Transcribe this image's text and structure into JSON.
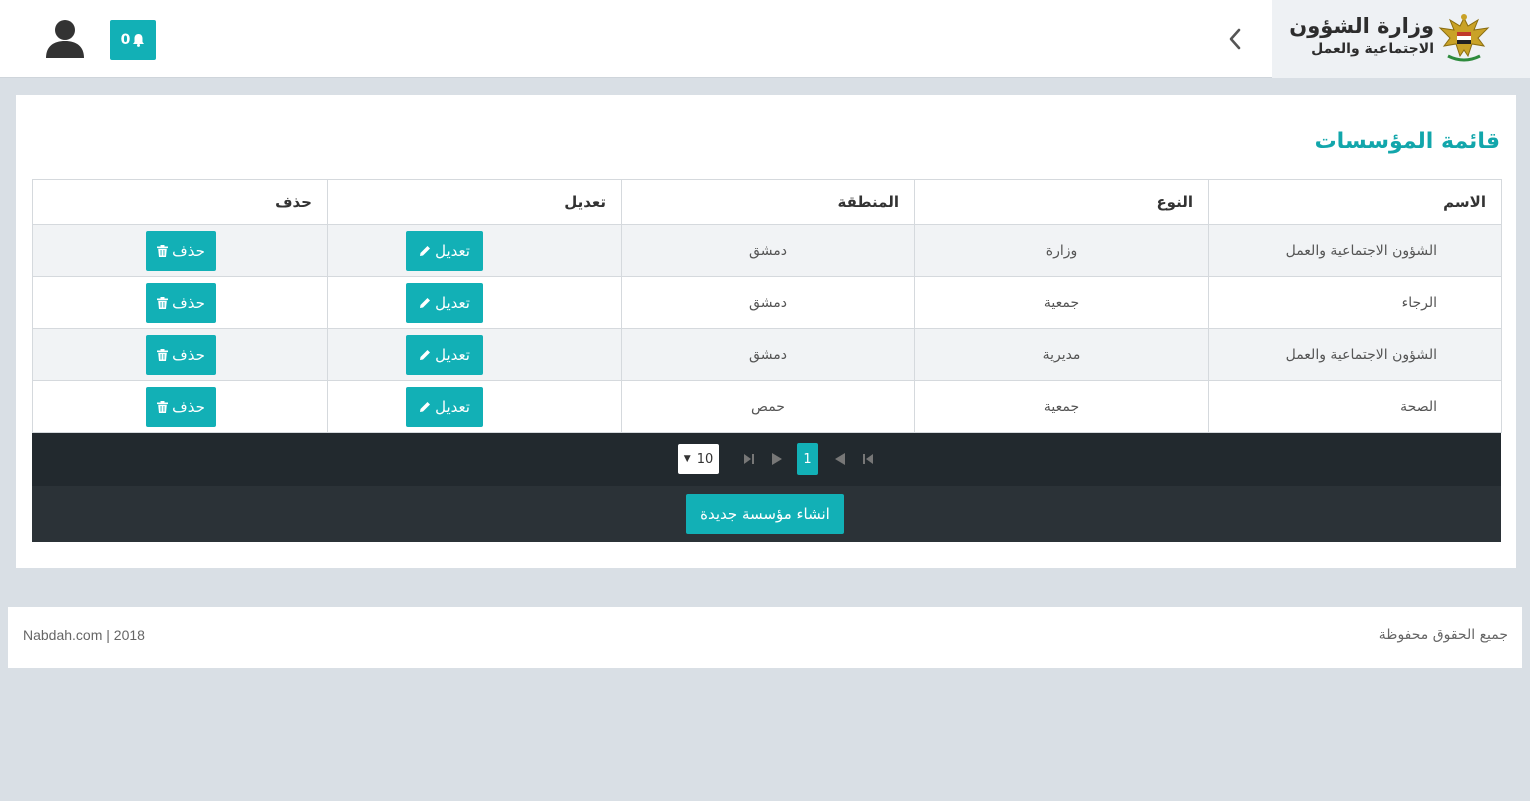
{
  "header": {
    "brand_line1": "وزارة الشؤون",
    "brand_line2": "الاجتماعية والعمل",
    "notifications_count": "0",
    "accent_color": "#12b0b6"
  },
  "panel": {
    "title": "قائمة المؤسسات",
    "columns": [
      "الاسم",
      "النوع",
      "المنطقة",
      "تعديل",
      "حذف"
    ],
    "rows": [
      {
        "name": "الشؤون الاجتماعية والعمل",
        "type": "وزارة",
        "region": "دمشق"
      },
      {
        "name": "الرجاء",
        "type": "جمعية",
        "region": "دمشق"
      },
      {
        "name": "الشؤون الاجتماعية والعمل",
        "type": "مديرية",
        "region": "دمشق"
      },
      {
        "name": "الصحة",
        "type": "جمعية",
        "region": "حمص"
      }
    ],
    "edit_label": "تعديل",
    "delete_label": "حذف",
    "pagination": {
      "page_size": "10",
      "current_page": "1"
    },
    "create_label": "انشاء مؤسسة جديدة"
  },
  "footer": {
    "rights": "جميع الحقوق محفوظة",
    "credit": "Nabdah.com | 2018"
  }
}
